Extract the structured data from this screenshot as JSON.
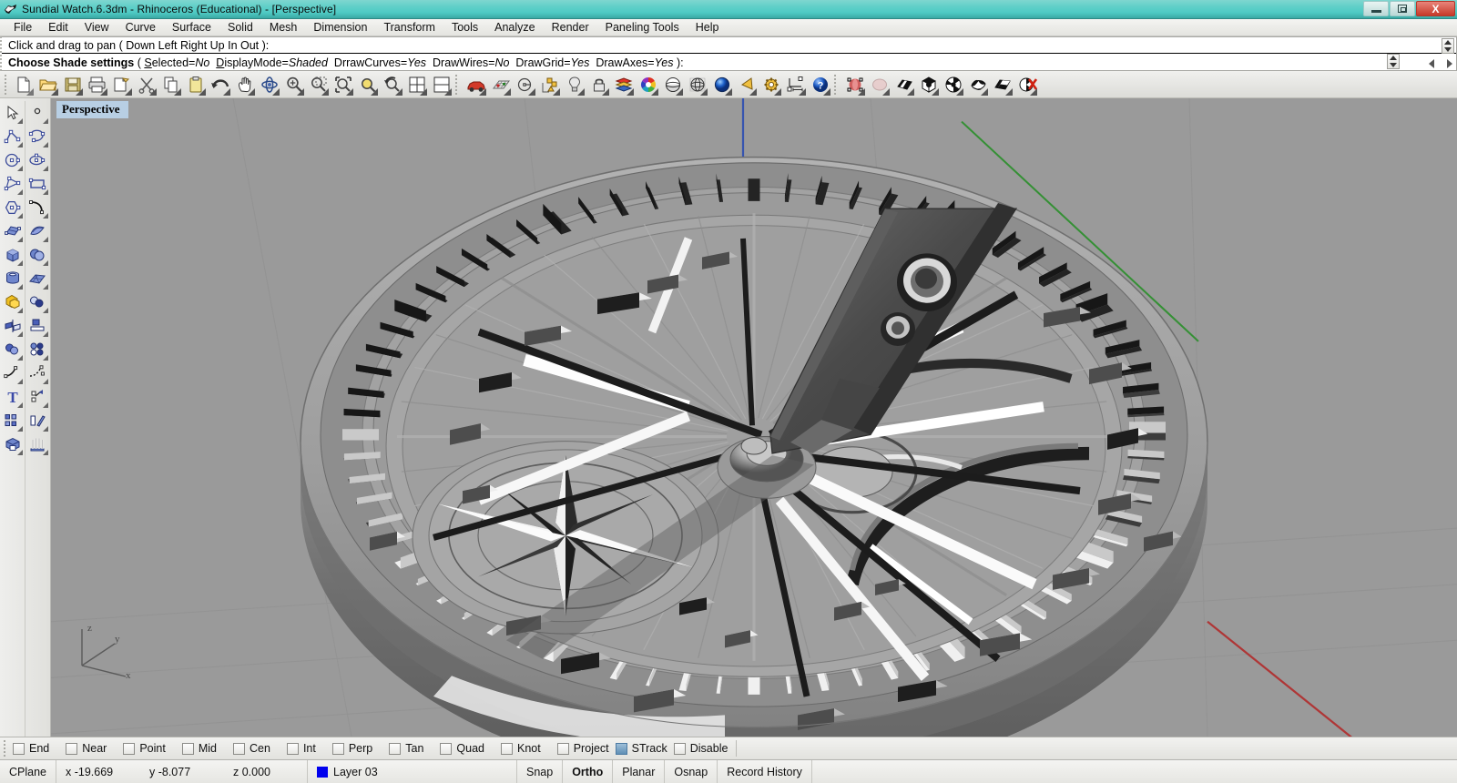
{
  "window": {
    "title": "Sundial Watch.6.3dm - Rhinoceros (Educational) - [Perspective]",
    "icon": "rhino-logo-icon",
    "controls": {
      "minimize": "minimize-button",
      "restore": "restore-button",
      "close_label": "X"
    },
    "titlebar_color": "#4ecac4"
  },
  "menubar": {
    "items": [
      {
        "label": "File"
      },
      {
        "label": "Edit"
      },
      {
        "label": "View"
      },
      {
        "label": "Curve"
      },
      {
        "label": "Surface"
      },
      {
        "label": "Solid"
      },
      {
        "label": "Mesh"
      },
      {
        "label": "Dimension"
      },
      {
        "label": "Transform"
      },
      {
        "label": "Tools"
      },
      {
        "label": "Analyze"
      },
      {
        "label": "Render"
      },
      {
        "label": "Paneling Tools"
      },
      {
        "label": "Help"
      }
    ]
  },
  "command_area": {
    "history_line": "Click and drag to pan ( Down  Left  Right  Up  In  Out ):",
    "prompt": {
      "command": "Choose Shade settings",
      "open_paren": "(",
      "options": [
        {
          "name": "S",
          "rest": "elected",
          "eq": "=",
          "value": "No",
          "value_italic": true
        },
        {
          "name": "D",
          "rest": "isplayMode",
          "eq": "=",
          "value": "Shaded",
          "value_italic": true
        },
        {
          "name": "D",
          "rest": "rawCurves",
          "eq": "=",
          "value": "Yes",
          "value_italic": true
        },
        {
          "name": "DrawW",
          "rest": "ires",
          "eq": "=",
          "value": "No",
          "value_italic": true
        },
        {
          "name": "DrawG",
          "rest": "rid",
          "eq": "=",
          "value": "Yes",
          "value_italic": true
        },
        {
          "name": "DrawA",
          "rest": "xes",
          "eq": "=",
          "value": "Yes",
          "value_italic": true
        }
      ],
      "close_paren": "):",
      "full_text": "Choose Shade settings ( Selected=No DisplayMode=Shaded DrawCurves=Yes DrawWires=No DrawGrid=Yes DrawAxes=Yes ):"
    }
  },
  "toolbar": {
    "groups": [
      {
        "buttons": [
          {
            "icon": "new-file-icon",
            "label": "New"
          },
          {
            "icon": "open-folder-icon",
            "label": "Open"
          },
          {
            "icon": "save-disk-icon",
            "label": "Save"
          },
          {
            "icon": "print-icon",
            "label": "Print"
          },
          {
            "icon": "copy-to-clipboard-icon",
            "label": "Copy to clipboard"
          },
          {
            "icon": "scissors-cut-icon",
            "label": "Cut"
          },
          {
            "icon": "copy-icon",
            "label": "Copy"
          },
          {
            "icon": "paste-icon",
            "label": "Paste"
          },
          {
            "icon": "undo-arrow-icon",
            "label": "Undo"
          },
          {
            "icon": "pan-hand-icon",
            "label": "Pan"
          },
          {
            "icon": "rotate-view-icon",
            "label": "Rotate view"
          },
          {
            "icon": "zoom-in-icon",
            "label": "Zoom in"
          },
          {
            "icon": "zoom-window-icon",
            "label": "Zoom window"
          },
          {
            "icon": "zoom-extents-icon",
            "label": "Zoom extents"
          },
          {
            "icon": "zoom-selected-icon",
            "label": "Zoom selected"
          },
          {
            "icon": "zoom-previous-icon",
            "label": "Zoom previous"
          },
          {
            "icon": "viewport-layout-icon",
            "label": "Viewport layout"
          },
          {
            "icon": "split-viewport-icon",
            "label": "Split viewport"
          }
        ]
      },
      {
        "buttons": [
          {
            "icon": "render-car-icon",
            "label": "Render"
          },
          {
            "icon": "grid-snap-icon",
            "label": "Grid"
          },
          {
            "icon": "arc-center-icon",
            "label": "Arc center"
          },
          {
            "icon": "object-snap-icon",
            "label": "Object snap"
          },
          {
            "icon": "light-bulb-icon",
            "label": "Light"
          },
          {
            "icon": "lock-icon",
            "label": "Lock"
          },
          {
            "icon": "layers-icon",
            "label": "Layers"
          },
          {
            "icon": "color-wheel-icon",
            "label": "Color"
          },
          {
            "icon": "shade-sphere-icon",
            "label": "Shade"
          },
          {
            "icon": "ghosted-sphere-icon",
            "label": "Ghosted"
          },
          {
            "icon": "render-sphere-icon",
            "label": "Rendered"
          },
          {
            "icon": "spotlight-icon",
            "label": "Spotlight"
          },
          {
            "icon": "settings-gear-icon",
            "label": "Options"
          },
          {
            "icon": "dimension-icon",
            "label": "Dimension"
          },
          {
            "icon": "help-icon",
            "label": "Help"
          }
        ]
      },
      {
        "buttons": [
          {
            "icon": "paneling-surface-icon",
            "label": "Paneling surface"
          },
          {
            "icon": "paneling-ghost-icon",
            "label": "Paneling ghost"
          },
          {
            "icon": "panel-grid-flat-icon",
            "label": "Panel grid"
          },
          {
            "icon": "panel-cube-icon",
            "label": "Panel cube"
          },
          {
            "icon": "panel-sphere-icon",
            "label": "Panel sphere"
          },
          {
            "icon": "panel-morph-icon",
            "label": "Panel morph"
          },
          {
            "icon": "panel-flat-icon",
            "label": "Panel flat"
          },
          {
            "icon": "panel-delete-icon",
            "label": "Panel delete"
          }
        ]
      }
    ]
  },
  "left_toolbox": {
    "columns": [
      {
        "buttons": [
          {
            "icon": "select-arrow-icon",
            "label": "Select objects"
          },
          {
            "icon": "polyline-icon",
            "label": "Polyline"
          },
          {
            "icon": "circle-center-icon",
            "label": "Circle"
          },
          {
            "icon": "curve-through-points-icon",
            "label": "Curve"
          },
          {
            "icon": "polygon-icon",
            "label": "Polygon"
          },
          {
            "icon": "surface-patch-icon",
            "label": "Surface from edge curves"
          },
          {
            "icon": "box-solid-icon",
            "label": "Box"
          },
          {
            "icon": "cylinder-icon",
            "label": "Cylinder"
          },
          {
            "icon": "boolean-union-icon",
            "label": "Boolean union"
          },
          {
            "icon": "split-icon",
            "label": "Split"
          },
          {
            "icon": "join-icon",
            "label": "Join"
          },
          {
            "icon": "fillet-curve-icon",
            "label": "Fillet curves"
          },
          {
            "icon": "text-object-icon",
            "label": "Text object"
          },
          {
            "icon": "array-icon",
            "label": "Array"
          },
          {
            "icon": "cap-planar-holes-icon",
            "label": "Cap planar holes"
          }
        ]
      },
      {
        "buttons": [
          {
            "icon": "point-object-icon",
            "label": "Point"
          },
          {
            "icon": "control-point-curve-icon",
            "label": "Control point curve"
          },
          {
            "icon": "ellipse-icon",
            "label": "Ellipse"
          },
          {
            "icon": "rectangle-icon",
            "label": "Rectangle"
          },
          {
            "icon": "arc-blend-icon",
            "label": "Arc"
          },
          {
            "icon": "surface-sweep-icon",
            "label": "Sweep surface"
          },
          {
            "icon": "sphere-icon",
            "label": "Sphere"
          },
          {
            "icon": "planar-surface-icon",
            "label": "Planar surface"
          },
          {
            "icon": "boolean-difference-icon",
            "label": "Boolean difference"
          },
          {
            "icon": "extrude-icon",
            "label": "Extrude"
          },
          {
            "icon": "trim-icon",
            "label": "Trim"
          },
          {
            "icon": "blend-curve-icon",
            "label": "Blend curve"
          },
          {
            "icon": "offset-icon",
            "label": "Offset"
          },
          {
            "icon": "mirror-icon",
            "label": "Mirror"
          },
          {
            "icon": "loft-icon",
            "label": "Loft"
          }
        ]
      }
    ]
  },
  "viewport": {
    "label": "Perspective",
    "display_mode": "Shaded",
    "background_color": "#9a9a9a",
    "axis_gizmo": {
      "z_label": "z",
      "y_label": "y",
      "x_label": "x"
    },
    "model_description": "Sundial watch — shaded grayscale 3D model with outer ring of Roman numeral markers, inner dial plates, radiating hour lines, central compass rose and a raised gnomon arm",
    "world_axes": {
      "x_axis_color": "#b03030",
      "y_axis_color": "#2f8f2f",
      "z_axis_color": "#3050b0"
    }
  },
  "osnap_bar": {
    "items": [
      {
        "label": "End",
        "checked": false
      },
      {
        "label": "Near",
        "checked": false
      },
      {
        "label": "Point",
        "checked": false
      },
      {
        "label": "Mid",
        "checked": false
      },
      {
        "label": "Cen",
        "checked": false
      },
      {
        "label": "Int",
        "checked": false
      },
      {
        "label": "Perp",
        "checked": false
      },
      {
        "label": "Tan",
        "checked": false
      },
      {
        "label": "Quad",
        "checked": false
      },
      {
        "label": "Knot",
        "checked": false
      },
      {
        "label": "Project",
        "checked": false
      },
      {
        "label": "STrack",
        "checked": true
      },
      {
        "label": "Disable",
        "checked": false
      }
    ]
  },
  "statusbar": {
    "cplane_label": "CPlane",
    "coords": {
      "x": "x -19.669",
      "y": "y -8.077",
      "z": "z 0.000"
    },
    "layer": {
      "name": "Layer 03",
      "color": "#0000ee"
    },
    "toggles": [
      {
        "label": "Snap",
        "active": false
      },
      {
        "label": "Ortho",
        "active": true
      },
      {
        "label": "Planar",
        "active": false
      },
      {
        "label": "Osnap",
        "active": false
      },
      {
        "label": "Record History",
        "active": false
      }
    ]
  }
}
